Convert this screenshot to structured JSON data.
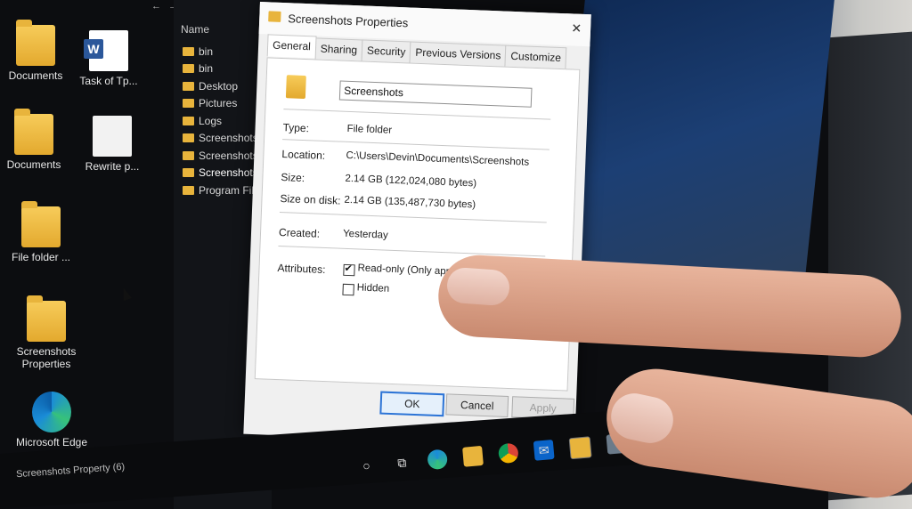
{
  "desktop": {
    "icons": [
      {
        "label": "Documents",
        "type": "folder"
      },
      {
        "label": "Task of Tp...",
        "type": "word"
      },
      {
        "label": "Documents",
        "type": "folder"
      },
      {
        "label": "Rewrite p...",
        "type": "doc"
      },
      {
        "label": "File folder ...",
        "type": "folder"
      },
      {
        "label": "Screenshots Properties",
        "type": "folder"
      },
      {
        "label": "Microsoft Edge",
        "type": "edge"
      }
    ]
  },
  "explorer": {
    "column_header": "Name",
    "items": [
      {
        "label": "bin"
      },
      {
        "label": "bin"
      },
      {
        "label": "Desktop"
      },
      {
        "label": "Pictures"
      },
      {
        "label": "Logs"
      },
      {
        "label": "Screenshots"
      },
      {
        "label": "Screenshots"
      },
      {
        "label": "Screenshots",
        "selected": true
      },
      {
        "label": "Program Files"
      }
    ]
  },
  "dialog": {
    "title": "Screenshots Properties",
    "tabs": [
      "General",
      "Sharing",
      "Security",
      "Previous Versions",
      "Customize"
    ],
    "active_tab": "General",
    "name_value": "Screenshots",
    "fields": {
      "type_label": "Type:",
      "type_value": "File folder",
      "location_label": "Location:",
      "location_value": "C:\\Users\\Devin\\Documents\\Screenshots",
      "size_label": "Size:",
      "size_value": "2.14 GB (122,024,080 bytes)",
      "size_on_disk_label": "Size on disk:",
      "size_on_disk_value": "2.14 GB (135,487,730 bytes)",
      "created_label": "Created:",
      "created_value": "Yesterday",
      "attributes_label": "Attributes:"
    },
    "attributes": {
      "readonly_label": "Read-only (Only applies to files in folder)",
      "readonly_checked": true,
      "hidden_label": "Hidden",
      "hidden_checked": false
    },
    "buttons": {
      "ok": "OK",
      "cancel": "Cancel",
      "apply": "Apply"
    }
  },
  "taskbar": {
    "status_text": "Screenshots Property (6)",
    "icons": [
      "search-icon",
      "task-view-icon",
      "edge-icon",
      "file-explorer-icon",
      "chrome-icon",
      "mail-icon",
      "folder-icon",
      "app-icon"
    ]
  }
}
